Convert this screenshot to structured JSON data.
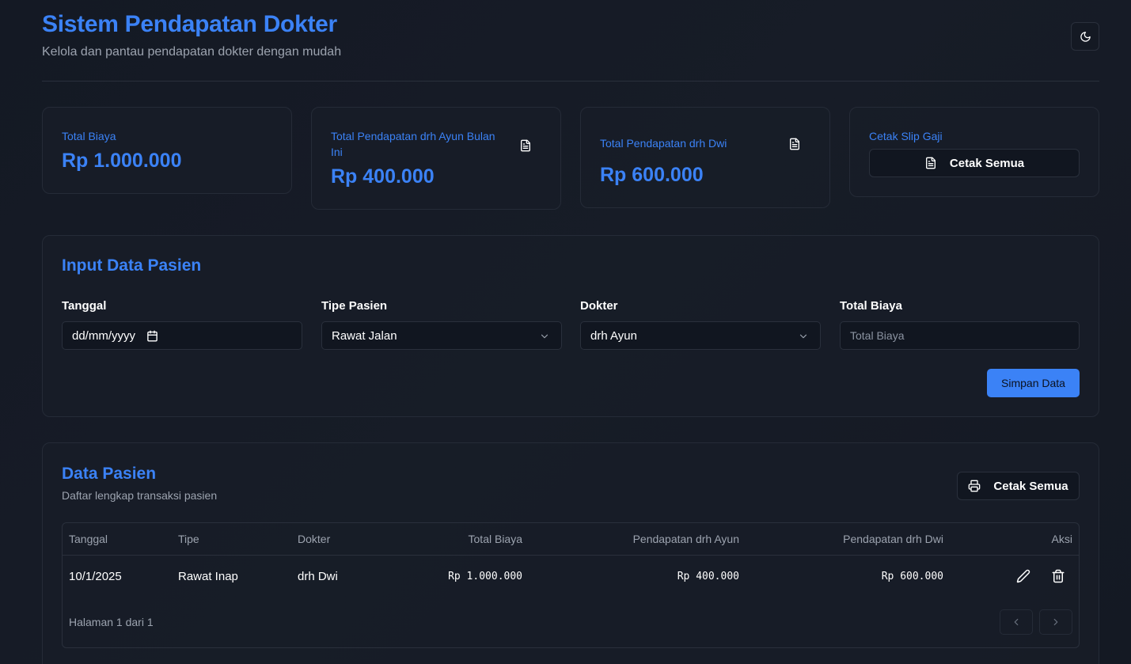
{
  "header": {
    "title": "Sistem Pendapatan Dokter",
    "subtitle": "Kelola dan pantau pendapatan dokter dengan mudah",
    "theme_icon": "moon-icon"
  },
  "stats": {
    "total_biaya": {
      "label": "Total Biaya",
      "value": "Rp 1.000.000"
    },
    "ayun": {
      "label": "Total Pendapatan drh Ayun Bulan Ini",
      "value": "Rp 400.000",
      "icon": "document-icon"
    },
    "dwi": {
      "label": "Total Pendapatan drh Dwi",
      "value": "Rp 600.000",
      "icon": "document-icon"
    },
    "slip": {
      "label": "Cetak Slip Gaji",
      "button_label": "Cetak Semua",
      "icon": "document-icon"
    }
  },
  "form": {
    "title": "Input Data Pasien",
    "tanggal": {
      "label": "Tanggal",
      "value": "dd/mm/yyyy"
    },
    "tipe": {
      "label": "Tipe Pasien",
      "value": "Rawat Jalan"
    },
    "dokter": {
      "label": "Dokter",
      "value": "drh Ayun"
    },
    "biaya": {
      "label": "Total Biaya",
      "placeholder": "Total Biaya"
    },
    "submit_label": "Simpan Data"
  },
  "table": {
    "title": "Data Pasien",
    "subtitle": "Daftar lengkap transaksi pasien",
    "print_label": "Cetak Semua",
    "columns": [
      "Tanggal",
      "Tipe",
      "Dokter",
      "Total Biaya",
      "Pendapatan drh Ayun",
      "Pendapatan drh Dwi",
      "Aksi"
    ],
    "rows": [
      {
        "tanggal": "10/1/2025",
        "tipe": "Rawat Inap",
        "dokter": "drh Dwi",
        "total": "Rp 1.000.000",
        "ayun": "Rp 400.000",
        "dwi": "Rp 600.000"
      }
    ],
    "page_info": "Halaman 1 dari 1"
  },
  "colors": {
    "accent": "#3b82f6",
    "background": "#151a24",
    "border": "#2a303c"
  }
}
